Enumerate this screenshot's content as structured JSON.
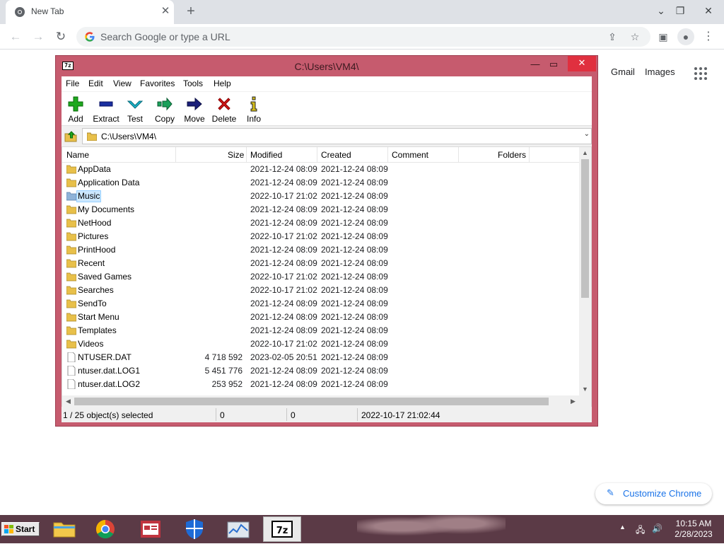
{
  "browser": {
    "tab_title": "New Tab",
    "tab_close": "✕",
    "new_tab": "+",
    "omnibox_placeholder": "Search Google or type a URL",
    "links": {
      "gmail": "Gmail",
      "images": "Images"
    },
    "customize_label": "Customize Chrome"
  },
  "zip": {
    "window_title": "C:\\Users\\VM4\\",
    "app_icon": "7z",
    "menu": [
      "File",
      "Edit",
      "View",
      "Favorites",
      "Tools",
      "Help"
    ],
    "tools": [
      {
        "label": "Add",
        "icon": "plus-icon",
        "color": "#1ea81e"
      },
      {
        "label": "Extract",
        "icon": "minus-icon",
        "color": "#1a2fa0"
      },
      {
        "label": "Test",
        "icon": "check-arrow-icon",
        "color": "#1bb3c9"
      },
      {
        "label": "Copy",
        "icon": "double-arrow-icon",
        "color": "#1aa05a"
      },
      {
        "label": "Move",
        "icon": "arrow-right-icon",
        "color": "#1a1f7a"
      },
      {
        "label": "Delete",
        "icon": "x-icon",
        "color": "#d01818"
      },
      {
        "label": "Info",
        "icon": "info-icon",
        "color": "#d8c01a"
      }
    ],
    "address": "C:\\Users\\VM4\\",
    "columns": [
      "Name",
      "Size",
      "Modified",
      "Created",
      "Comment",
      "Folders"
    ],
    "rows": [
      {
        "name": "AppData",
        "type": "folder",
        "size": "",
        "modified": "2021-12-24 08:09",
        "created": "2021-12-24 08:09"
      },
      {
        "name": "Application Data",
        "type": "folder",
        "size": "",
        "modified": "2021-12-24 08:09",
        "created": "2021-12-24 08:09"
      },
      {
        "name": "Music",
        "type": "folder",
        "size": "",
        "modified": "2022-10-17 21:02",
        "created": "2021-12-24 08:09",
        "selected": true
      },
      {
        "name": "My Documents",
        "type": "folder",
        "size": "",
        "modified": "2021-12-24 08:09",
        "created": "2021-12-24 08:09"
      },
      {
        "name": "NetHood",
        "type": "folder",
        "size": "",
        "modified": "2021-12-24 08:09",
        "created": "2021-12-24 08:09"
      },
      {
        "name": "Pictures",
        "type": "folder",
        "size": "",
        "modified": "2022-10-17 21:02",
        "created": "2021-12-24 08:09"
      },
      {
        "name": "PrintHood",
        "type": "folder",
        "size": "",
        "modified": "2021-12-24 08:09",
        "created": "2021-12-24 08:09"
      },
      {
        "name": "Recent",
        "type": "folder",
        "size": "",
        "modified": "2021-12-24 08:09",
        "created": "2021-12-24 08:09"
      },
      {
        "name": "Saved Games",
        "type": "folder",
        "size": "",
        "modified": "2022-10-17 21:02",
        "created": "2021-12-24 08:09"
      },
      {
        "name": "Searches",
        "type": "folder",
        "size": "",
        "modified": "2022-10-17 21:02",
        "created": "2021-12-24 08:09"
      },
      {
        "name": "SendTo",
        "type": "folder",
        "size": "",
        "modified": "2021-12-24 08:09",
        "created": "2021-12-24 08:09"
      },
      {
        "name": "Start Menu",
        "type": "folder",
        "size": "",
        "modified": "2021-12-24 08:09",
        "created": "2021-12-24 08:09"
      },
      {
        "name": "Templates",
        "type": "folder",
        "size": "",
        "modified": "2021-12-24 08:09",
        "created": "2021-12-24 08:09"
      },
      {
        "name": "Videos",
        "type": "folder",
        "size": "",
        "modified": "2022-10-17 21:02",
        "created": "2021-12-24 08:09"
      },
      {
        "name": "NTUSER.DAT",
        "type": "file",
        "size": "4 718 592",
        "modified": "2023-02-05 20:51",
        "created": "2021-12-24 08:09"
      },
      {
        "name": "ntuser.dat.LOG1",
        "type": "file",
        "size": "5 451 776",
        "modified": "2021-12-24 08:09",
        "created": "2021-12-24 08:09"
      },
      {
        "name": "ntuser.dat.LOG2",
        "type": "file",
        "size": "253 952",
        "modified": "2021-12-24 08:09",
        "created": "2021-12-24 08:09"
      }
    ],
    "status": {
      "selection": "1 / 25 object(s) selected",
      "size1": "0",
      "size2": "0",
      "date": "2022-10-17 21:02:44"
    },
    "colors": {
      "frame": "#c65b6e",
      "close": "#e0303f",
      "selection": "#cce8ff"
    }
  },
  "taskbar": {
    "start_label": "Start",
    "apps": [
      "file-explorer-icon",
      "chrome-icon",
      "news-icon",
      "shield-icon",
      "task-manager-icon",
      "7zip-icon"
    ],
    "time": "10:15 AM",
    "date": "2/28/2023"
  }
}
